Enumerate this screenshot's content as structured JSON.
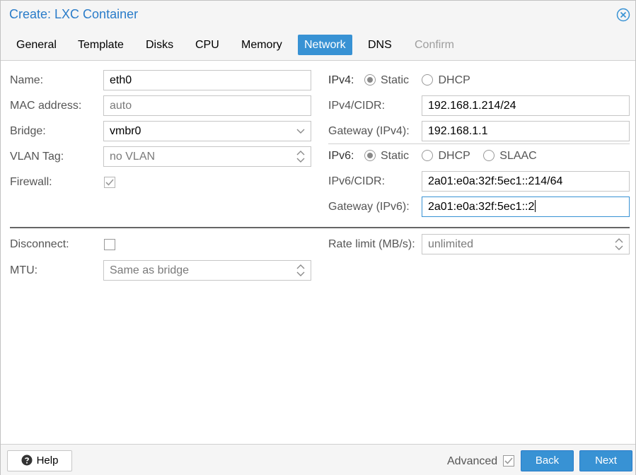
{
  "window": {
    "title": "Create: LXC Container"
  },
  "icons": {
    "close": "close-circle-icon",
    "help": "question-circle-icon",
    "dropdown": "chevron-down-icon",
    "spinner": "spinner-arrows-icon",
    "check": "checkmark-icon"
  },
  "colors": {
    "accent": "#3892d4",
    "title": "#2a7cc9",
    "disabled_tab": "#9e9e9e"
  },
  "tabs": [
    {
      "label": "General"
    },
    {
      "label": "Template"
    },
    {
      "label": "Disks"
    },
    {
      "label": "CPU"
    },
    {
      "label": "Memory"
    },
    {
      "label": "Network"
    },
    {
      "label": "DNS"
    },
    {
      "label": "Confirm"
    }
  ],
  "left": {
    "name": {
      "label": "Name:",
      "value": "eth0"
    },
    "mac": {
      "label": "MAC address:",
      "placeholder": "auto"
    },
    "bridge": {
      "label": "Bridge:",
      "value": "vmbr0"
    },
    "vlan": {
      "label": "VLAN Tag:",
      "placeholder": "no VLAN"
    },
    "firewall": {
      "label": "Firewall:",
      "checked": true
    },
    "disconnect": {
      "label": "Disconnect:",
      "checked": false
    },
    "mtu": {
      "label": "MTU:",
      "placeholder": "Same as bridge"
    }
  },
  "right": {
    "ipv4": {
      "label": "IPv4:",
      "options": [
        "Static",
        "DHCP"
      ],
      "selected": "Static"
    },
    "ipv4_cidr": {
      "label": "IPv4/CIDR:",
      "value": "192.168.1.214/24"
    },
    "gw4": {
      "label": "Gateway (IPv4):",
      "value": "192.168.1.1"
    },
    "ipv6": {
      "label": "IPv6:",
      "options": [
        "Static",
        "DHCP",
        "SLAAC"
      ],
      "selected": "Static"
    },
    "ipv6_cidr": {
      "label": "IPv6/CIDR:",
      "value": "2a01:e0a:32f:5ec1::214/64"
    },
    "gw6": {
      "label": "Gateway (IPv6):",
      "value": "2a01:e0a:32f:5ec1::2"
    },
    "rate": {
      "label": "Rate limit (MB/s):",
      "placeholder": "unlimited"
    }
  },
  "footer": {
    "help": "Help",
    "advanced": "Advanced",
    "advanced_checked": true,
    "back": "Back",
    "next": "Next"
  }
}
